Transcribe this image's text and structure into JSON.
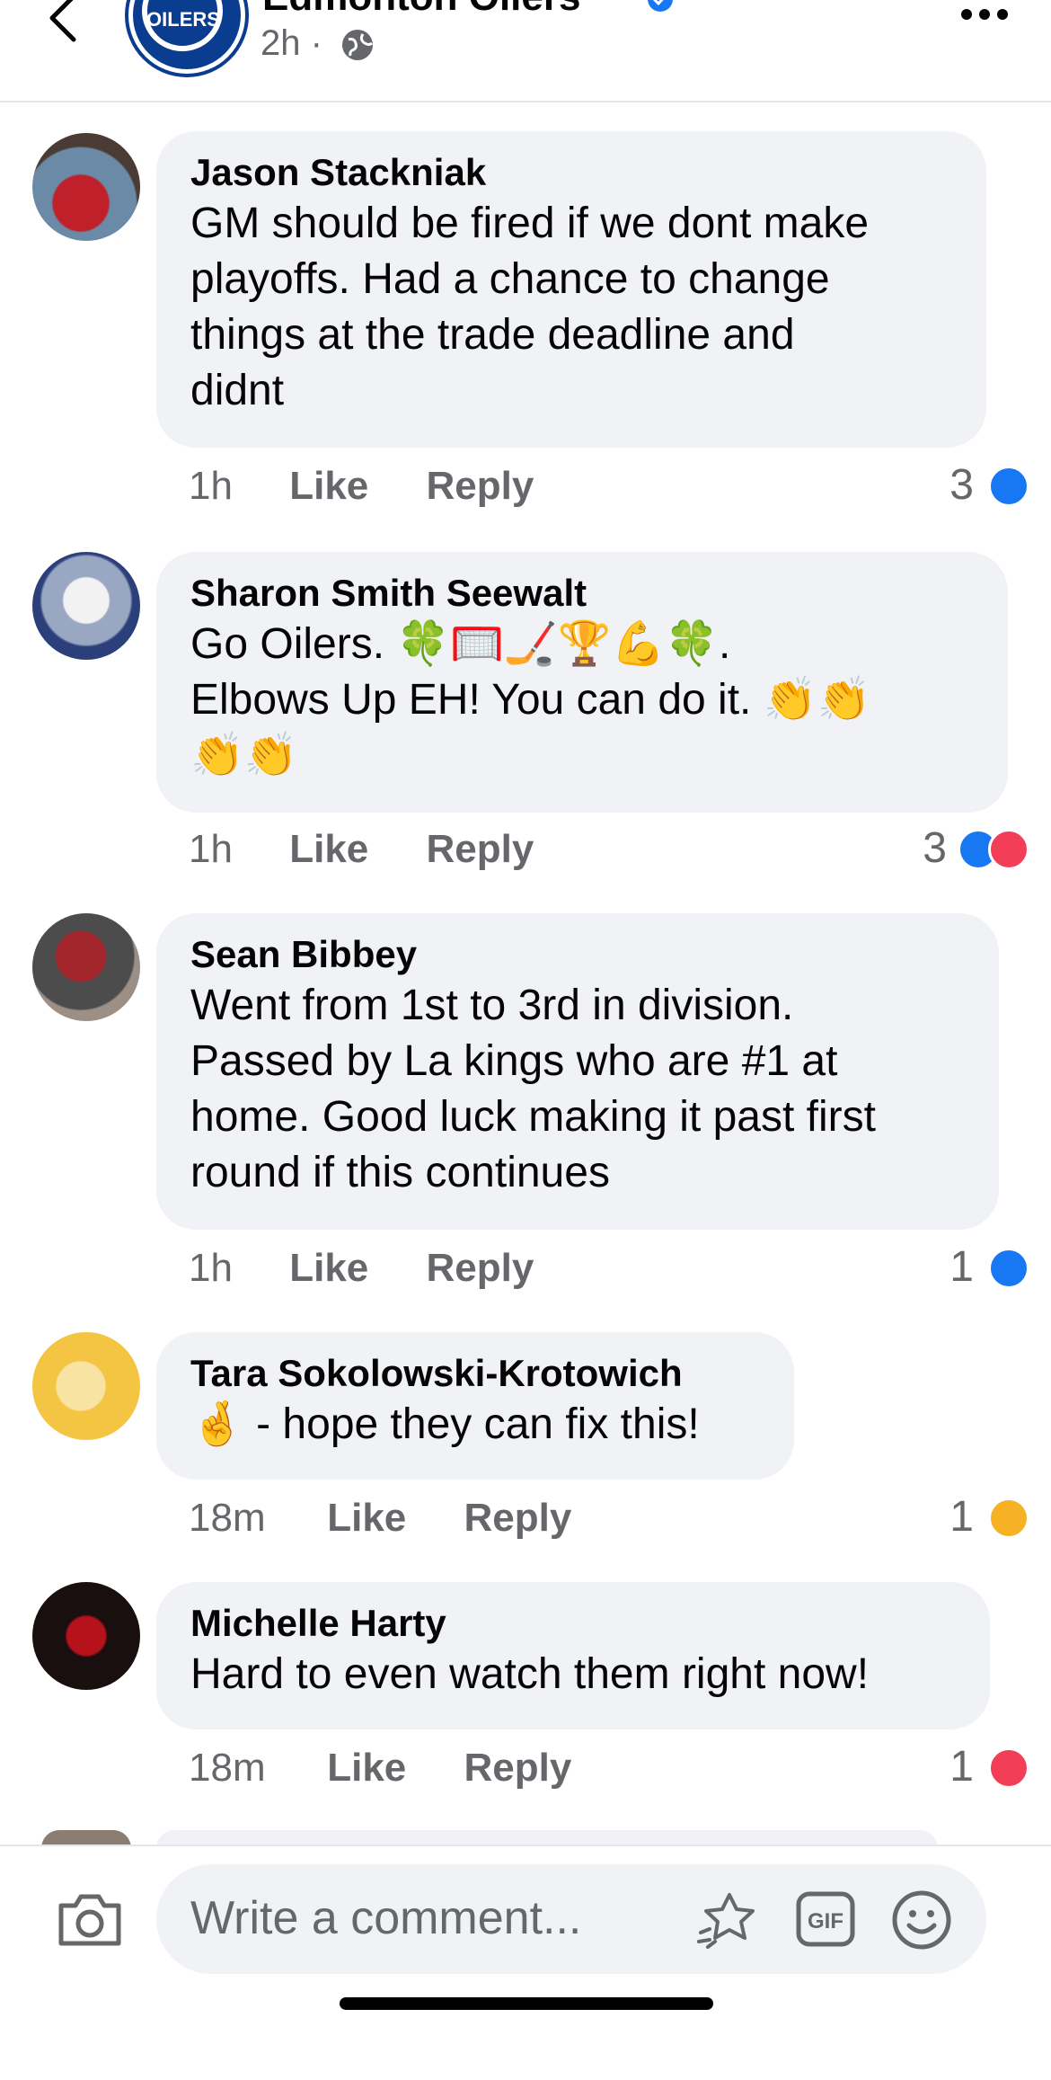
{
  "header": {
    "page_name": "Edmonton Oilers",
    "avatar_text": "OILERS",
    "time": "2h ·",
    "icons": {
      "back": "chevron-left-icon",
      "verified": "verified-badge-icon",
      "audience": "globe-icon",
      "more": "more-dots-icon"
    }
  },
  "comments": [
    {
      "author": "Jason Stackniak",
      "lines": [
        "GM should be fired if we dont make",
        "playoffs. Had a chance to change",
        "things at the trade deadline and",
        "didnt"
      ],
      "time": "1h",
      "like": "Like",
      "reply": "Reply",
      "reaction_count": "3",
      "reactions": [
        "like"
      ]
    },
    {
      "author": "Sharon Smith Seewalt",
      "lines": [
        "Go Oilers.  🍀🥅🏒🏆💪🍀.",
        "Elbows Up EH!  You can do it.  👏👏",
        "👏👏"
      ],
      "time": "1h",
      "like": "Like",
      "reply": "Reply",
      "reaction_count": "3",
      "reactions": [
        "like",
        "love"
      ]
    },
    {
      "author": "Sean Bibbey",
      "lines": [
        "Went from 1st to 3rd in division.",
        "Passed by La kings who are #1 at",
        "home. Good luck making it past first",
        "round if this continues"
      ],
      "time": "1h",
      "like": "Like",
      "reply": "Reply",
      "reaction_count": "1",
      "reactions": [
        "like"
      ]
    },
    {
      "author": "Tara Sokolowski-Krotowich",
      "lines": [
        "🤞 - hope they can fix this!"
      ],
      "time": "18m",
      "like": "Like",
      "reply": "Reply",
      "reaction_count": "1",
      "reactions": [
        "care"
      ]
    },
    {
      "author": "Michelle Harty",
      "lines": [
        "Hard to even watch them right now!"
      ],
      "time": "18m",
      "like": "Like",
      "reply": "Reply",
      "reaction_count": "1",
      "reactions": [
        "love"
      ]
    }
  ],
  "composer": {
    "placeholder": "Write a comment...",
    "gif_label": "GIF",
    "icons": {
      "camera": "camera-icon",
      "sticker": "sticker-icon",
      "gif": "gif-icon",
      "emoji": "emoji-icon"
    }
  },
  "colors": {
    "accent": "#1877f2",
    "love": "#f33e58",
    "bubble": "#f0f2f5",
    "secondary_text": "#65676b"
  }
}
